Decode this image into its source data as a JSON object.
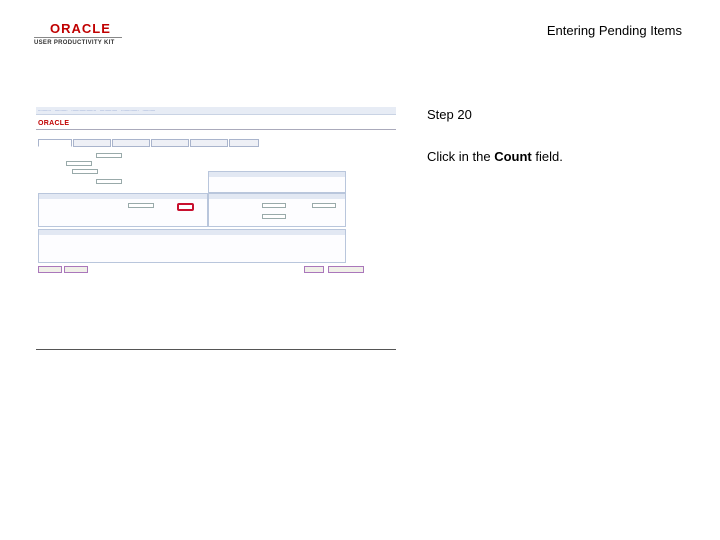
{
  "header": {
    "logo_brand": "ORACLE",
    "logo_sub": "USER PRODUCTIVITY KIT",
    "title": "Entering Pending Items"
  },
  "step": {
    "number": "Step 20",
    "instr_prefix": "Click in the ",
    "instr_field": "Count",
    "instr_suffix": " field."
  },
  "screenshot": {
    "brand": "ORACLE",
    "highlight_target": "Count field"
  }
}
